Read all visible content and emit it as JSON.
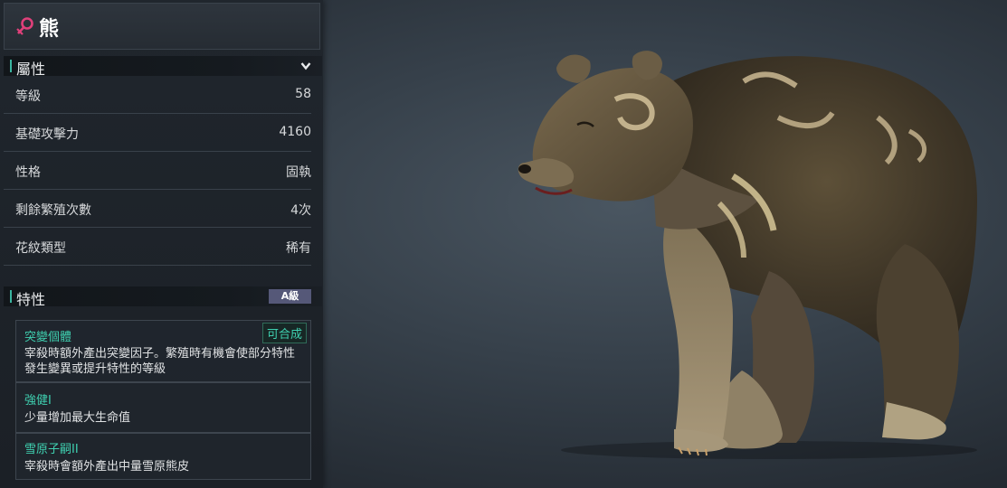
{
  "creature": {
    "name": "熊",
    "gender_icon": "female-icon"
  },
  "attributes": {
    "header": "屬性",
    "rows": [
      {
        "label": "等級",
        "value": "58"
      },
      {
        "label": "基礎攻擊力",
        "value": "4160"
      },
      {
        "label": "性格",
        "value": "固執"
      },
      {
        "label": "剩餘繁殖次數",
        "value": "4次"
      },
      {
        "label": "花紋類型",
        "value": "稀有"
      }
    ]
  },
  "traits": {
    "header": "特性",
    "grade": "A級",
    "items": [
      {
        "name": "突變個體",
        "tag": "可合成",
        "desc_line1": "宰殺時額外產出突變因子。繁殖時有機會使部分特性",
        "desc_line2": "發生變異或提升特性的等級"
      },
      {
        "name": "強健I",
        "desc_line1": "少量增加最大生命值"
      },
      {
        "name": "雪原子嗣II",
        "desc_line1": "宰殺時會額外產出中量雪原熊皮"
      }
    ]
  },
  "colors": {
    "accent_teal": "#3fd0b0",
    "female_pink": "#e0407a",
    "grade_badge": "#555878"
  }
}
